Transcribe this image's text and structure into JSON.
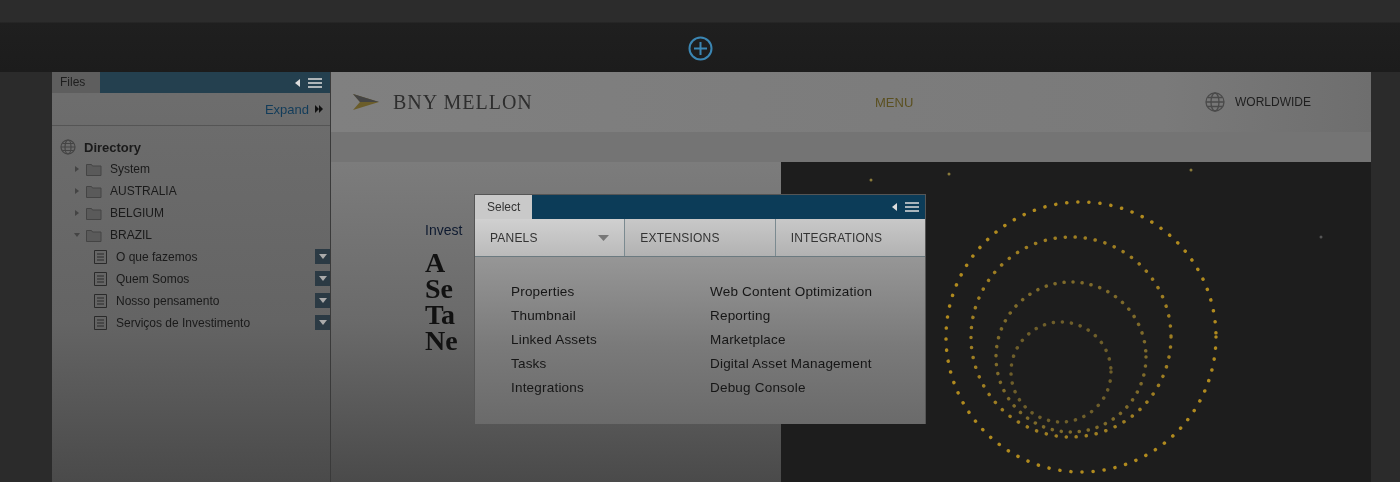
{
  "files_panel": {
    "title": "Files",
    "expand_label": "Expand",
    "tree": [
      {
        "label": "Directory",
        "kind": "root",
        "children": [
          {
            "label": "System",
            "kind": "folder",
            "expanded": false
          },
          {
            "label": "AUSTRALIA",
            "kind": "folder",
            "expanded": false
          },
          {
            "label": "BELGIUM",
            "kind": "folder",
            "expanded": false
          },
          {
            "label": "BRAZIL",
            "kind": "folder",
            "expanded": true,
            "children": [
              {
                "label": "O que fazemos",
                "kind": "page"
              },
              {
                "label": "Quem Somos",
                "kind": "page"
              },
              {
                "label": "Nosso pensamento",
                "kind": "page"
              },
              {
                "label": "Serviços de Investimento",
                "kind": "page"
              }
            ]
          }
        ]
      }
    ]
  },
  "site": {
    "logo": "BNY MELLON",
    "menu": "MENU",
    "region": "WORLDWIDE",
    "kicker": "Invest",
    "headline": [
      "A",
      "Se",
      "Ta",
      "Ne"
    ]
  },
  "dialog": {
    "title_tabs": [
      {
        "label": "Select",
        "selected": true
      }
    ],
    "tabs": [
      {
        "label": "PANELS",
        "selected": true
      },
      {
        "label": "EXTENSIONS",
        "selected": false
      },
      {
        "label": "INTEGRATIONS",
        "selected": false
      }
    ],
    "columns": [
      [
        "Properties",
        "Thumbnail",
        "Linked Assets",
        "Tasks",
        "Integrations"
      ],
      [
        "Web Content Optimization",
        "Reporting",
        "Marketplace",
        "Digital Asset Management",
        "Debug Console"
      ]
    ]
  }
}
